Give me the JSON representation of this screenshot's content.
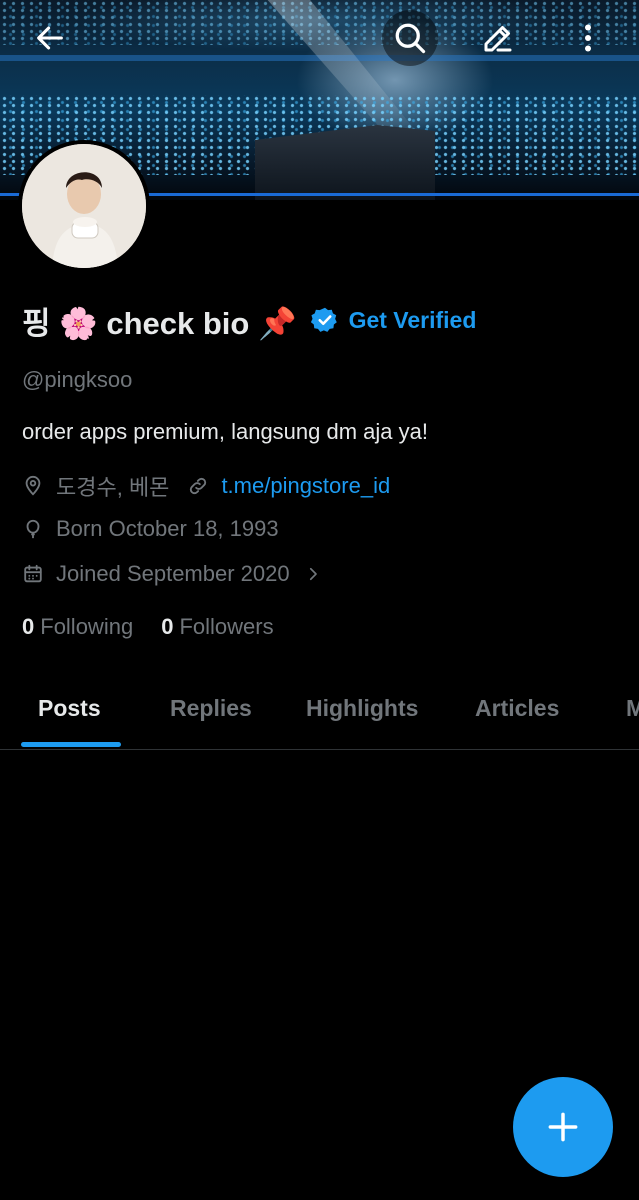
{
  "header": {
    "back_icon": "arrow-left-icon",
    "search_icon": "search-icon",
    "edit_icon": "pencil-icon",
    "more_icon": "more-vertical-icon"
  },
  "profile": {
    "display_name": "핑 🌸 check bio 📌",
    "verified_badge_icon": "verified-badge-icon",
    "get_verified_label": "Get Verified",
    "handle": "@pingksoo",
    "bio": "order apps premium, langsung dm aja ya!",
    "location": "도경수, 베몬",
    "website": "t.me/pingstore_id",
    "birthday": "Born October 18, 1993",
    "joined": "Joined September 2020",
    "following_count": "0",
    "following_label": "Following",
    "followers_count": "0",
    "followers_label": "Followers"
  },
  "tabs": [
    {
      "label": "Posts",
      "active": true
    },
    {
      "label": "Replies",
      "active": false
    },
    {
      "label": "Highlights",
      "active": false
    },
    {
      "label": "Articles",
      "active": false
    },
    {
      "label": "M",
      "active": false
    }
  ],
  "fab": {
    "icon": "plus-icon"
  },
  "colors": {
    "accent": "#1d9bf0",
    "background": "#000000",
    "text_primary": "#e7e9ea",
    "text_secondary": "#71767b"
  }
}
